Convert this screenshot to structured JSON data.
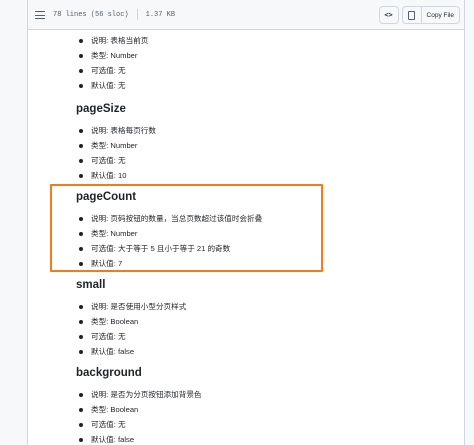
{
  "file_header": {
    "line_info": "78 lines (56 sloc)",
    "size": "1.37 KB",
    "raw_button": "Copy File",
    "code_icon": "code-icon",
    "file_icon": "file-icon",
    "lines_icon": "lines-icon"
  },
  "sections": [
    {
      "title": "",
      "items": [
        "说明: 表格当前页",
        "类型: Number",
        "可选值: 无",
        "默认值: 无"
      ]
    },
    {
      "title": "pageSize",
      "items": [
        "说明: 表格每页行数",
        "类型: Number",
        "可选值: 无",
        "默认值: 10"
      ]
    },
    {
      "title": "pageCount",
      "items": [
        "说明: 页码按钮的数量，当总页数超过该值时会折叠",
        "类型: Number",
        "可选值: 大于等于 5 且小于等于 21 的奇数",
        "默认值: 7"
      ]
    },
    {
      "title": "small",
      "items": [
        "说明: 是否使用小型分页样式",
        "类型: Boolean",
        "可选值: 无",
        "默认值: false"
      ]
    },
    {
      "title": "background",
      "items": [
        "说明: 是否为分页按钮添加背景色",
        "类型: Boolean",
        "可选值: 无",
        "默认值: false"
      ]
    }
  ],
  "colors": {
    "highlight": "#f07c1e",
    "header_bg": "#f6f8fa",
    "text": "#1f2328"
  }
}
